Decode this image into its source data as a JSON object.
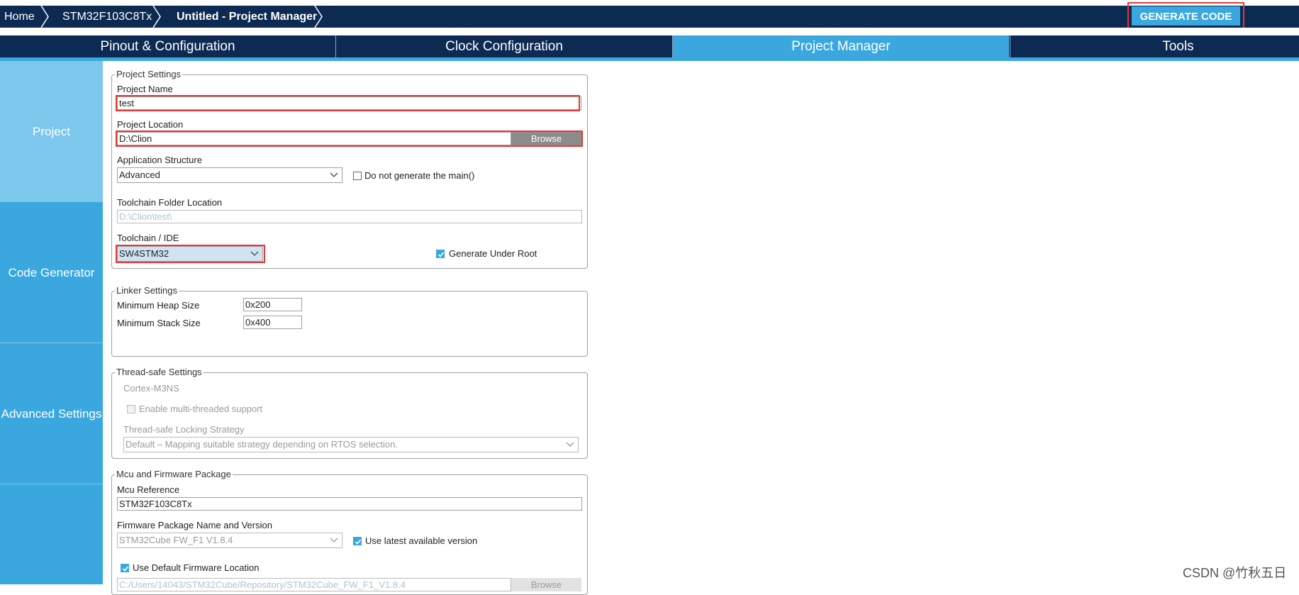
{
  "breadcrumb": {
    "items": [
      "Home",
      "STM32F103C8Tx",
      "Untitled - Project Manager"
    ]
  },
  "header": {
    "generate_label": "GENERATE CODE"
  },
  "tabs": [
    {
      "label": "Pinout & Configuration"
    },
    {
      "label": "Clock Configuration"
    },
    {
      "label": "Project Manager"
    },
    {
      "label": "Tools"
    }
  ],
  "sidebar": {
    "items": [
      {
        "label": "Project"
      },
      {
        "label": "Code Generator"
      },
      {
        "label": "Advanced Settings"
      }
    ]
  },
  "project_settings": {
    "legend": "Project Settings",
    "name_label": "Project Name",
    "name_value": "test",
    "location_label": "Project Location",
    "location_value": "D:\\Clion",
    "browse_label": "Browse",
    "structure_label": "Application Structure",
    "structure_value": "Advanced",
    "no_main_label": "Do not generate the main()",
    "toolchain_folder_label": "Toolchain Folder Location",
    "toolchain_folder_value": "D:\\Clion\\test\\",
    "toolchain_label": "Toolchain / IDE",
    "toolchain_value": "SW4STM32",
    "generate_under_root_label": "Generate Under Root"
  },
  "linker_settings": {
    "legend": "Linker Settings",
    "heap_label": "Minimum Heap Size",
    "heap_value": "0x200",
    "stack_label": "Minimum Stack Size",
    "stack_value": "0x400"
  },
  "thread_safe": {
    "legend": "Thread-safe Settings",
    "core": "Cortex-M3NS",
    "multithread_label": "Enable multi-threaded support",
    "strategy_label": "Thread-safe Locking Strategy",
    "strategy_value": "Default  –  Mapping suitable strategy depending on RTOS selection."
  },
  "mcu_firmware": {
    "legend": "Mcu and Firmware Package",
    "mcu_label": "Mcu Reference",
    "mcu_value": "STM32F103C8Tx",
    "fw_label": "Firmware Package Name and Version",
    "fw_value": "STM32Cube FW_F1 V1.8.4",
    "latest_label": "Use latest available version",
    "default_location_label": "Use Default Firmware Location",
    "fw_path_value": "C:/Users/14043/STM32Cube/Repository/STM32Cube_FW_F1_V1.8.4",
    "fw_browse_label": "Browse"
  },
  "watermark": "CSDN @竹秋五日",
  "colors": {
    "navy": "#0d2a52",
    "accent": "#3aa8df",
    "highlight_red": "#e53935"
  }
}
